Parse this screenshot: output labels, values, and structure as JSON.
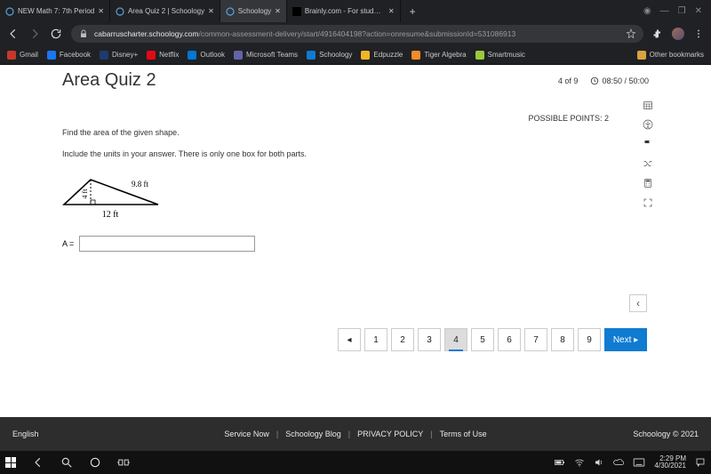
{
  "browser": {
    "tabs": [
      {
        "title": "NEW Math 7: 7th Period"
      },
      {
        "title": "Area Quiz 2 | Schoology"
      },
      {
        "title": "Schoology"
      },
      {
        "title": "Brainly.com - For students. By"
      }
    ],
    "url_host": "cabarruscharter.schoology.com",
    "url_path": "/common-assessment-delivery/start/4916404198?action=onresume&submissionId=531086913",
    "bookmarks": [
      "Gmail",
      "Facebook",
      "Disney+",
      "Netflix",
      "Outlook",
      "Microsoft Teams",
      "Schoology",
      "Edpuzzle",
      "Tiger Algebra",
      "Smartmusic"
    ],
    "other_bookmarks": "Other bookmarks"
  },
  "quiz": {
    "title": "Area Quiz 2",
    "progress": "4 of 9",
    "timer": "08:50 / 50:00",
    "possible_points": "POSSIBLE POINTS: 2",
    "question_line1": "Find the area of the given shape.",
    "question_line2": "Include the units in your answer.  There is only one box for both parts.",
    "triangle": {
      "height_label": "4 ft",
      "hyp_label": "9.8 ft",
      "base_label": "12 ft"
    },
    "answer_label": "A =",
    "answer_value": "",
    "pager": [
      "1",
      "2",
      "3",
      "4",
      "5",
      "6",
      "7",
      "8",
      "9"
    ],
    "active_page": "4",
    "next_label": "Next ▸",
    "prev_label": "◂"
  },
  "footer": {
    "lang": "English",
    "links": [
      "Service Now",
      "Schoology Blog",
      "PRIVACY POLICY",
      "Terms of Use"
    ],
    "copyright": "Schoology © 2021"
  },
  "taskbar": {
    "time": "2:29 PM",
    "date": "4/30/2021"
  },
  "colors": {
    "bm": [
      "#c5392b",
      "#1877f2",
      "#1f3a6e",
      "#e50914",
      "#0078d4",
      "#6264a7",
      "#0f7bd1",
      "#f0b429",
      "#f28c28",
      "#9aca3c"
    ]
  }
}
